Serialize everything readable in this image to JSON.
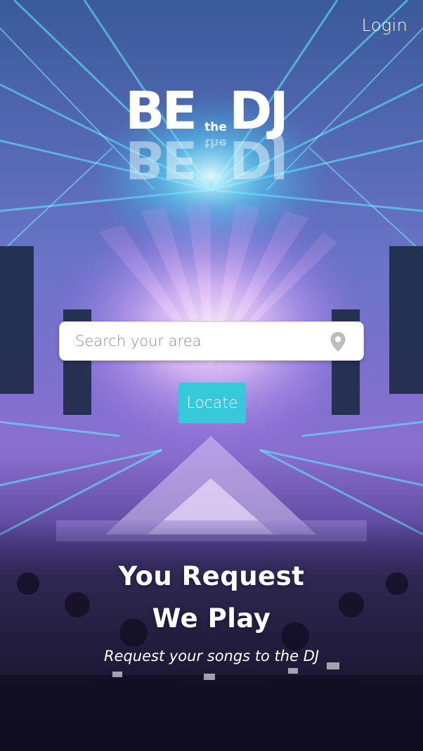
{
  "header": {
    "login_label": "Login"
  },
  "logo": {
    "word_be": "BE",
    "word_the": "the",
    "word_dj": "DJ"
  },
  "search": {
    "value": "",
    "placeholder": "Search your area",
    "icon": "map-pin-icon"
  },
  "locate": {
    "label": "Locate"
  },
  "hero": {
    "line1": "You Request",
    "line2": "We Play",
    "subline": "Request your songs to the DJ"
  },
  "theme": {
    "accent": "#35c9d9",
    "beam_color": "#4ff0ff",
    "stage_glow": "#f3d8ff",
    "crowd_dark": "#1b1630"
  }
}
